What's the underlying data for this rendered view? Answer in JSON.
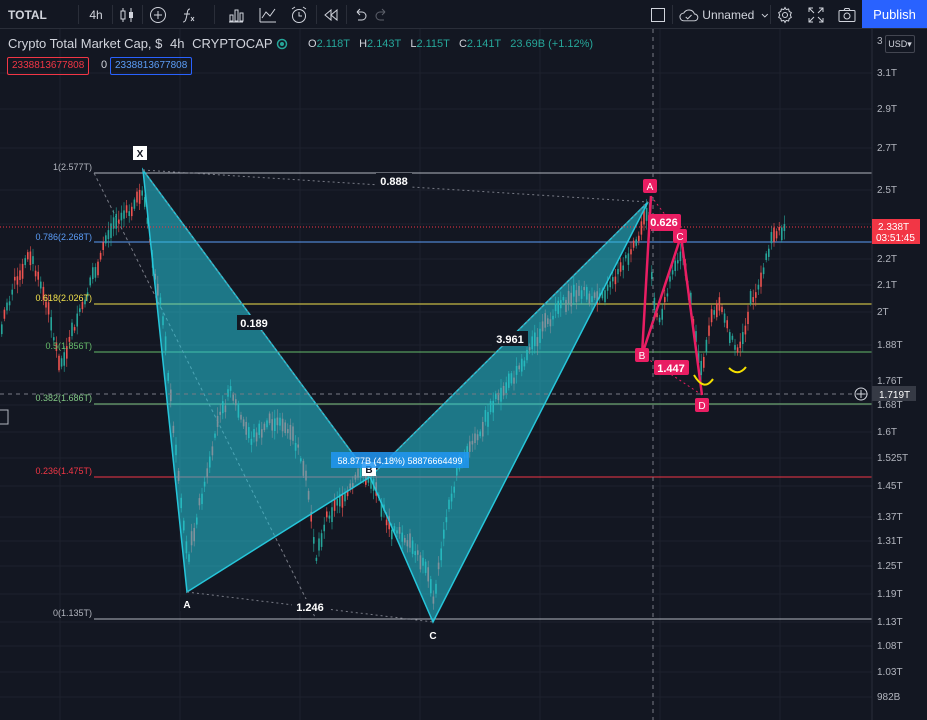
{
  "toolbar": {
    "symbol": "TOTAL",
    "interval": "4h",
    "layout_name": "Unnamed",
    "publish_label": "Publish"
  },
  "legend": {
    "title": "Crypto Total Market Cap, $",
    "interval": "4h",
    "exchange": "CRYPTOCAP",
    "o_label": "O",
    "o_value": "2.118T",
    "h_label": "H",
    "h_value": "2.143T",
    "l_label": "L",
    "l_value": "2.115T",
    "c_label": "C",
    "c_value": "2.141T",
    "change": "23.69B (+1.12%)",
    "indicator_a": "2338813677808",
    "indicator_zero": "0",
    "indicator_b": "2338813677808"
  },
  "price_scale": {
    "currency": "USD",
    "top_tick": "3",
    "ticks": [
      "3.1T",
      "2.9T",
      "2.7T",
      "2.5T",
      "2.3T",
      "2.2T",
      "2.1T",
      "2T",
      "1.88T",
      "1.76T",
      "1.68T",
      "1.6T",
      "1.525T",
      "1.45T",
      "1.37T",
      "1.31T",
      "1.25T",
      "1.19T",
      "1.13T",
      "1.08T",
      "1.03T",
      "982B"
    ],
    "last_price": "2.338T",
    "countdown": "03:51:45",
    "crosshair_price": "1.719T"
  },
  "fib_levels": [
    {
      "label": "1(2.577T)",
      "color": "#b2b5be"
    },
    {
      "label": "0.786(2.268T)",
      "color": "#5b9cf6"
    },
    {
      "label": "0.618(2.026T)",
      "color": "#f0e04c"
    },
    {
      "label": "0.5(1.856T)",
      "color": "#66bb6a"
    },
    {
      "label": "0.382(1.686T)",
      "color": "#81c784"
    },
    {
      "label": "0.236(1.475T)",
      "color": "#f23645"
    },
    {
      "label": "0(1.135T)",
      "color": "#b2b5be"
    }
  ],
  "pattern_blue": {
    "points": [
      "X",
      "A",
      "B",
      "C"
    ],
    "ratios": [
      "0.888",
      "0.189",
      "1.246",
      "3.961"
    ],
    "range_label": "58.877B (4.18%) 58876664499",
    "color": "#26c6da"
  },
  "pattern_red": {
    "points": [
      "A",
      "B",
      "C",
      "D"
    ],
    "ratios": [
      "0.626",
      "1.447"
    ],
    "color": "#e91e63"
  },
  "colors": {
    "background": "#131722",
    "up_candle": "#26a69a",
    "down_candle": "#ef5350",
    "accent": "#2962ff",
    "highlight_curve": "#f5e000"
  }
}
